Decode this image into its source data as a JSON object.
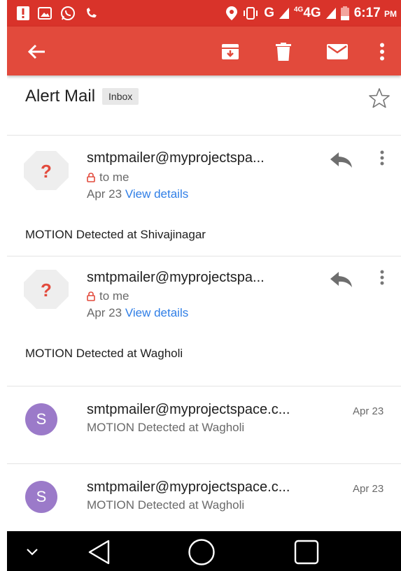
{
  "status_bar": {
    "network": "G",
    "network_lte": "4G",
    "network_lte_sup": "4G",
    "time": "6:17",
    "ampm": "PM"
  },
  "subject": {
    "title": "Alert Mail",
    "label": "Inbox"
  },
  "messages_expanded": [
    {
      "from": "smtpmailer@myprojectspa...",
      "to": "to me",
      "date": "Apr 23",
      "details_link": "View details",
      "body": "MOTION Detected at Shivajinagar",
      "avatar": "?"
    },
    {
      "from": "smtpmailer@myprojectspa...",
      "to": "to me",
      "date": "Apr 23",
      "details_link": "View details",
      "body": "MOTION Detected at Wagholi",
      "avatar": "?"
    }
  ],
  "messages_collapsed": [
    {
      "avatar": "S",
      "from": "smtpmailer@myprojectspace.c...",
      "date": "Apr 23",
      "snippet": "MOTION Detected at Wagholi"
    },
    {
      "avatar": "S",
      "from": "smtpmailer@myprojectspace.c...",
      "date": "Apr 23",
      "snippet": "MOTION Detected at Wagholi"
    }
  ],
  "colors": {
    "status_bar": "#d9332a",
    "toolbar": "#e24a3c",
    "link": "#2f7ee6",
    "avatar_purple": "#9b7ac9"
  },
  "icons": {
    "toolbar": [
      "back-arrow-icon",
      "archive-icon",
      "delete-icon",
      "mark-unread-icon",
      "overflow-menu-icon"
    ],
    "navigation": [
      "chevron-down-icon",
      "back-icon",
      "home-icon",
      "recents-icon"
    ]
  }
}
